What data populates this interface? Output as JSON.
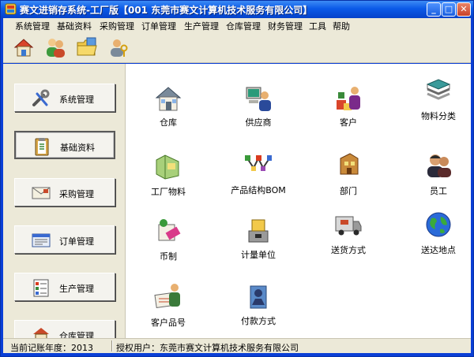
{
  "window": {
    "title": "赛文进销存系统-工厂版【001 东莞市赛文计算机技术服务有限公司】"
  },
  "menu": [
    "系统管理",
    "基础资料",
    "采购管理",
    "订单管理",
    "生产管理",
    "仓库管理",
    "财务管理",
    "工具",
    "帮助"
  ],
  "toolbar": [
    "home-icon",
    "users-icon",
    "folder-icon",
    "user-key-icon"
  ],
  "nav": [
    {
      "label": "系统管理",
      "icon": "tools-icon"
    },
    {
      "label": "基础资料",
      "icon": "clipboard-icon"
    },
    {
      "label": "采购管理",
      "icon": "envelope-icon"
    },
    {
      "label": "订单管理",
      "icon": "form-icon"
    },
    {
      "label": "生产管理",
      "icon": "checklist-icon"
    },
    {
      "label": "仓库管理",
      "icon": "warehouse-icon"
    }
  ],
  "tiles": [
    {
      "label": "仓库",
      "icon": "house-icon"
    },
    {
      "label": "供应商",
      "icon": "supplier-icon"
    },
    {
      "label": "客户",
      "icon": "customer-icon"
    },
    {
      "label": "物料分类",
      "icon": "stack-icon"
    },
    {
      "label": "工厂物料",
      "icon": "materials-icon"
    },
    {
      "label": "产品结构BOM",
      "icon": "structure-icon"
    },
    {
      "label": "部门",
      "icon": "department-icon"
    },
    {
      "label": "员工",
      "icon": "employee-icon"
    },
    {
      "label": "币制",
      "icon": "currency-icon"
    },
    {
      "label": "计量单位",
      "icon": "scale-icon"
    },
    {
      "label": "送货方式",
      "icon": "truck-icon"
    },
    {
      "label": "送达地点",
      "icon": "globe-icon"
    },
    {
      "label": "客户品号",
      "icon": "customer-item-icon"
    },
    {
      "label": "付款方式",
      "icon": "payment-icon"
    }
  ],
  "status": {
    "year_label": "当前记账年度：2013",
    "user_label": "授权用户：东莞市赛文计算机技术服务有限公司"
  },
  "colors": {
    "titlebar": "#0b5ae8",
    "panel": "#ece9d8",
    "main": "#ffffff"
  }
}
